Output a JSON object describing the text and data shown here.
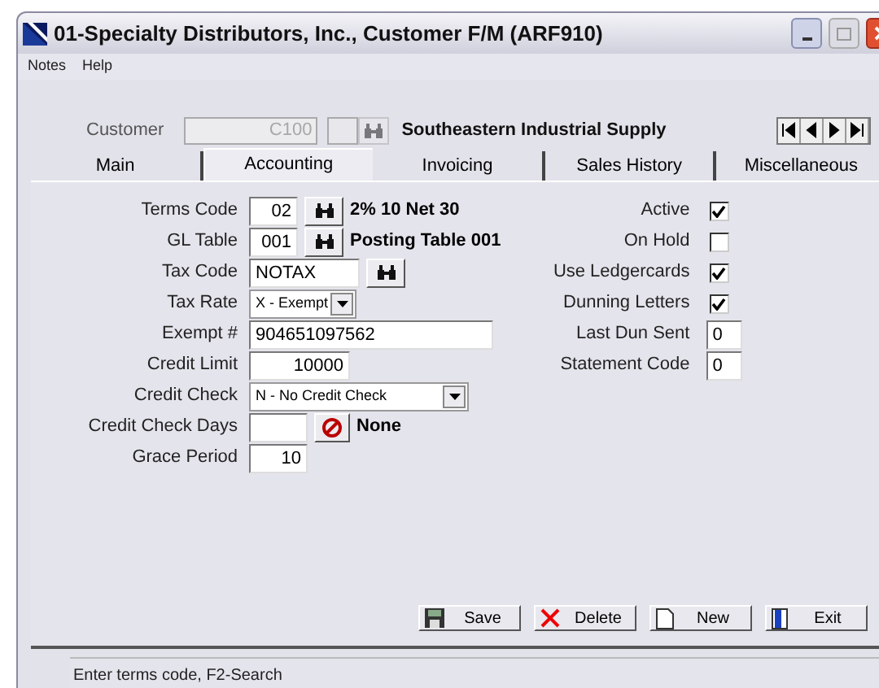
{
  "window": {
    "title": "01-Specialty Distributors, Inc., Customer F/M (ARF910)"
  },
  "menu": [
    "Notes",
    "Help"
  ],
  "customer": {
    "label": "Customer",
    "value": "C100",
    "name": "Southeastern Industrial Supply"
  },
  "tabs": [
    {
      "label": "Main",
      "selected": false
    },
    {
      "label": "Accounting",
      "selected": true
    },
    {
      "label": "Invoicing",
      "selected": false
    },
    {
      "label": "Sales History",
      "selected": false
    },
    {
      "label": "Miscellaneous",
      "selected": false
    }
  ],
  "left_fields": [
    {
      "kind": "lookup",
      "label": "Terms Code",
      "value": "02",
      "description": "2% 10 Net 30"
    },
    {
      "kind": "lookup",
      "label": "GL Table",
      "value": "001",
      "description": "Posting Table 001"
    },
    {
      "kind": "lookup_wide",
      "label": "Tax Code",
      "value": "NOTAX"
    },
    {
      "kind": "select",
      "label": "Tax Rate",
      "value": "X - Exempt"
    },
    {
      "kind": "text_long",
      "label": "Exempt #",
      "value": "904651097562"
    },
    {
      "kind": "number",
      "label": "Credit Limit",
      "value": "10000"
    },
    {
      "kind": "select_long",
      "label": "Credit Check",
      "value": "N - No Credit Check"
    },
    {
      "kind": "clear",
      "label": "Credit Check Days",
      "description": "None"
    },
    {
      "kind": "number_short",
      "label": "Grace Period",
      "value": "10"
    }
  ],
  "right_fields": [
    {
      "kind": "checkbox",
      "label": "Active",
      "checked": true
    },
    {
      "kind": "checkbox",
      "label": "On Hold",
      "checked": false
    },
    {
      "kind": "checkbox",
      "label": "Use Ledgercards",
      "checked": true
    },
    {
      "kind": "checkbox",
      "label": "Dunning Letters",
      "checked": true
    },
    {
      "kind": "input",
      "label": "Last Dun Sent",
      "value": "0"
    },
    {
      "kind": "input",
      "label": "Statement Code",
      "value": "0"
    }
  ],
  "buttons": [
    {
      "kind": "save",
      "label": "Save"
    },
    {
      "kind": "delete",
      "label": "Delete"
    },
    {
      "kind": "new",
      "label": "New"
    },
    {
      "kind": "exit",
      "label": "Exit"
    }
  ],
  "status_bar": "Enter terms code, F2-Search"
}
